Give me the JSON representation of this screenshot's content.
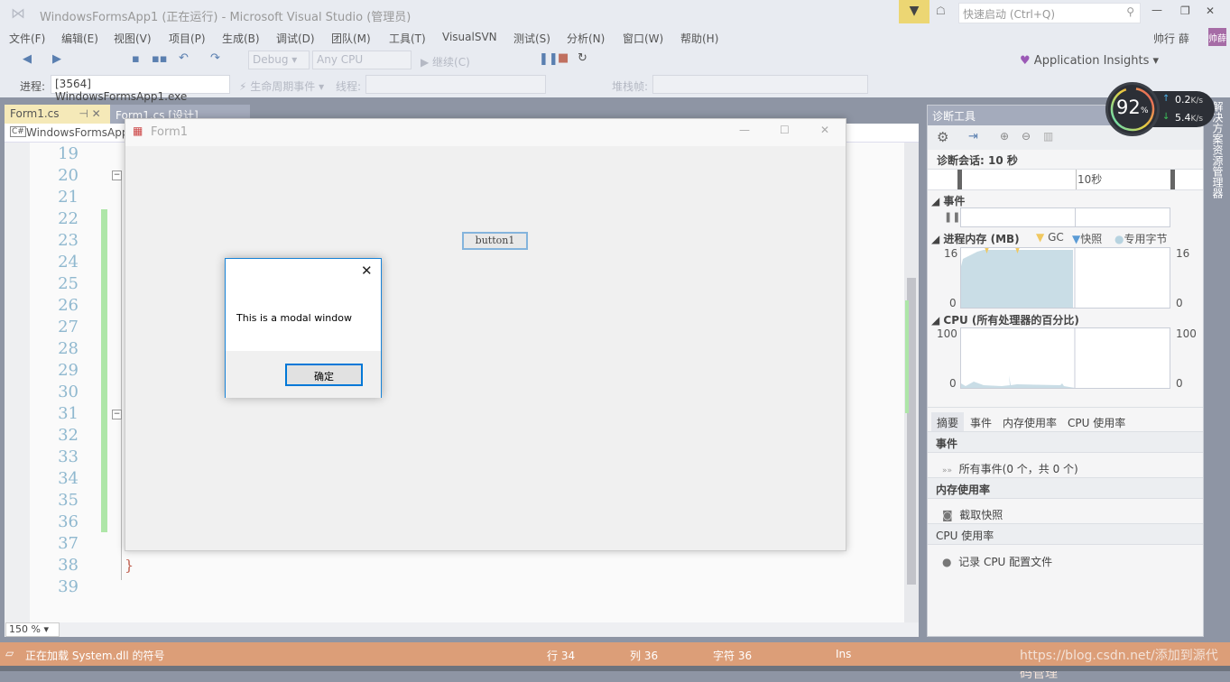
{
  "window": {
    "title": "WindowsFormsApp1 (正在运行) - Microsoft Visual Studio (管理员)",
    "quick_launch_placeholder": "快速启动 (Ctrl+Q)",
    "user": "帅行 薛",
    "avatar": "帅薛"
  },
  "menu": [
    "文件(F)",
    "编辑(E)",
    "视图(V)",
    "项目(P)",
    "生成(B)",
    "调试(D)",
    "团队(M)",
    "工具(T)",
    "VisualSVN",
    "测试(S)",
    "分析(N)",
    "窗口(W)",
    "帮助(H)"
  ],
  "toolbar": {
    "config": "Debug",
    "platform": "Any CPU",
    "continue": "继续(C)",
    "app_insights": "Application Insights"
  },
  "toolbar2": {
    "process_label": "进程:",
    "process": "[3564] WindowsFormsApp1.exe",
    "lifecycle": "生命周期事件",
    "thread_label": "线程:",
    "stack_label": "堆栈帧:"
  },
  "tabs": [
    {
      "label": "Form1.cs",
      "active": true
    },
    {
      "label": "Form1.cs [设计]",
      "active": false
    }
  ],
  "nav": {
    "project": "WindowsFormsApp1"
  },
  "editor": {
    "line_numbers": [
      "19",
      "20",
      "21",
      "22",
      "23",
      "24",
      "25",
      "26",
      "27",
      "28",
      "29",
      "30",
      "31",
      "32",
      "33",
      "34",
      "35",
      "36",
      "37",
      "38",
      "39"
    ],
    "closing_brace": "}",
    "zoom": "150 %"
  },
  "form1": {
    "title": "Form1",
    "button": "button1"
  },
  "modal": {
    "message": "This is a modal window",
    "ok": "确定"
  },
  "network": {
    "percent": "92",
    "percent_unit": "%",
    "up": "0.2",
    "down": "5.4",
    "unit": "K/s"
  },
  "diagnostics": {
    "title": "诊断工具",
    "session": "诊断会话: 10 秒",
    "timeline_label": "10秒",
    "events_header": "事件",
    "memory_header": "进程内存 (MB)",
    "legend": [
      "GC",
      "快照",
      "专用字节"
    ],
    "mem_max": "16",
    "mem_min": "0",
    "cpu_header": "CPU (所有处理器的百分比)",
    "cpu_max": "100",
    "cpu_min": "0",
    "tabs": [
      "摘要",
      "事件",
      "内存使用率",
      "CPU 使用率"
    ],
    "sections": [
      {
        "title": "事件",
        "item": "所有事件(0 个，共 0 个)"
      },
      {
        "title": "内存使用率",
        "item": "截取快照"
      },
      {
        "title": "CPU 使用率",
        "item": "记录 CPU 配置文件"
      }
    ]
  },
  "side_tab": "解决方案资源管理器",
  "status": {
    "message": "正在加载 System.dll 的符号",
    "row": "行 34",
    "col": "列 36",
    "char": "字符 36",
    "mode": "Ins",
    "right": "https://blog.csdn.net/添加到源代码管理"
  },
  "colors": {
    "status_bar": "#dc9e78",
    "active_tab": "#f5e9b8",
    "accent": "#0078d7"
  }
}
